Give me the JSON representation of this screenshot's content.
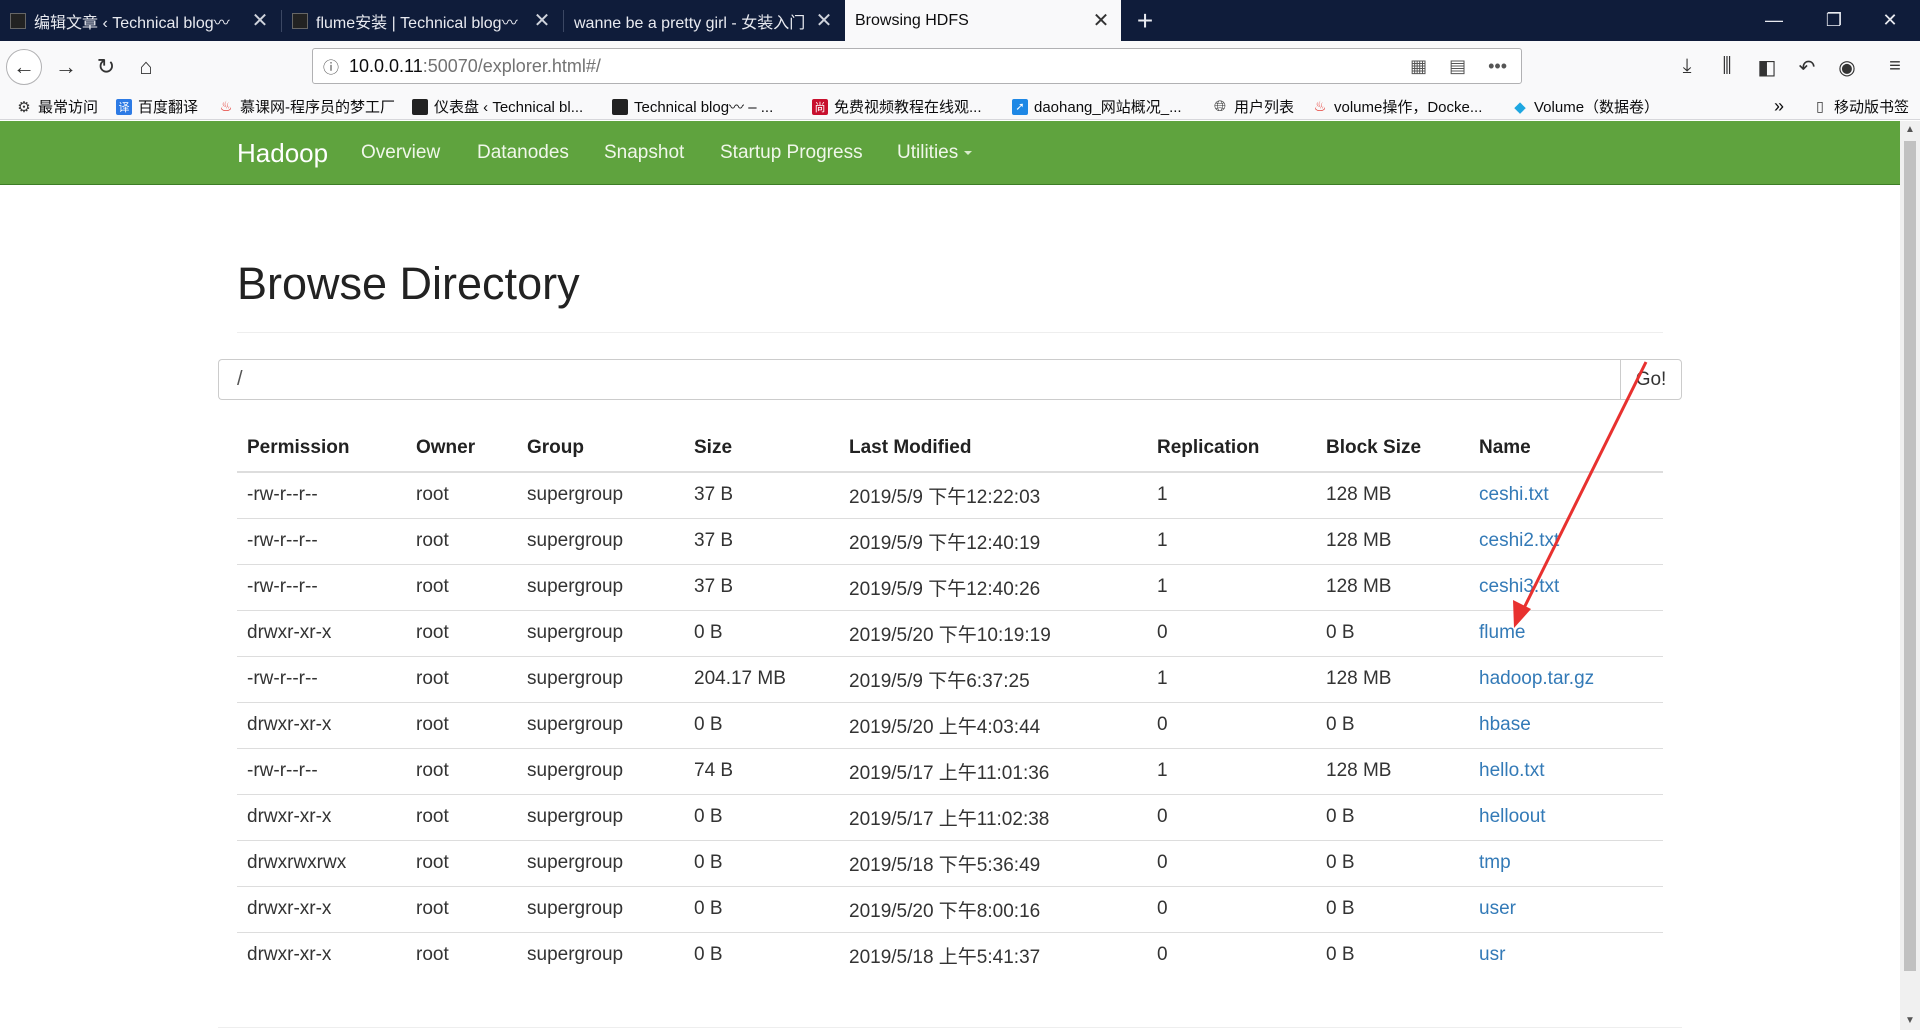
{
  "browser": {
    "tabs": [
      {
        "label": "编辑文章 ‹ Technical blog〰",
        "close": "✕"
      },
      {
        "label": "flume安装 | Technical blog〰",
        "close": "✕"
      },
      {
        "label": "wanne be a pretty girl - 女装入门",
        "close": "✕"
      },
      {
        "label": "Browsing HDFS",
        "close": "✕"
      }
    ],
    "new_tab": "+",
    "window_controls": {
      "minimize": "—",
      "restore": "❐",
      "close": "✕"
    },
    "url": {
      "host": "10.0.0.11",
      "path": ":50070/explorer.html#/"
    },
    "bookmarks": [
      {
        "label": "最常访问",
        "icon": "gear-icon"
      },
      {
        "label": "百度翻译",
        "icon": "translate-icon",
        "icon_text": "译",
        "color": "#2d7be5"
      },
      {
        "label": "慕课网-程序员的梦工厂",
        "icon": "flame-icon",
        "color": "#e2231a"
      },
      {
        "label": "仪表盘 ‹ Technical bl...",
        "icon": "site-icon"
      },
      {
        "label": "Technical blog〰 – ...",
        "icon": "site-icon"
      },
      {
        "label": "免费视频教程在线观...",
        "icon": "shang-icon",
        "icon_text": "尚",
        "color": "#c8102e"
      },
      {
        "label": "daohang_网站概况_...",
        "icon": "bolt-icon",
        "color": "#1e88e5"
      },
      {
        "label": "用户列表",
        "icon": "globe-icon"
      },
      {
        "label": "volume操作，Docke...",
        "icon": "flame-icon",
        "color": "#e2231a"
      },
      {
        "label": "Volume（数据卷）",
        "icon": "diamond-icon",
        "color": "#1ea7e1"
      }
    ],
    "bookmarks_overflow": "»",
    "mobile_bookmarks": "移动版书签"
  },
  "hadoop": {
    "brand": "Hadoop",
    "nav": [
      "Overview",
      "Datanodes",
      "Snapshot",
      "Startup Progress",
      "Utilities"
    ]
  },
  "page": {
    "title": "Browse Directory",
    "path_input": "/",
    "go_label": "Go!"
  },
  "table": {
    "headers": [
      "Permission",
      "Owner",
      "Group",
      "Size",
      "Last Modified",
      "Replication",
      "Block Size",
      "Name"
    ],
    "rows": [
      [
        "-rw-r--r--",
        "root",
        "supergroup",
        "37 B",
        "2019/5/9 下午12:22:03",
        "1",
        "128 MB",
        "ceshi.txt"
      ],
      [
        "-rw-r--r--",
        "root",
        "supergroup",
        "37 B",
        "2019/5/9 下午12:40:19",
        "1",
        "128 MB",
        "ceshi2.txt"
      ],
      [
        "-rw-r--r--",
        "root",
        "supergroup",
        "37 B",
        "2019/5/9 下午12:40:26",
        "1",
        "128 MB",
        "ceshi3.txt"
      ],
      [
        "drwxr-xr-x",
        "root",
        "supergroup",
        "0 B",
        "2019/5/20 下午10:19:19",
        "0",
        "0 B",
        "flume"
      ],
      [
        "-rw-r--r--",
        "root",
        "supergroup",
        "204.17 MB",
        "2019/5/9 下午6:37:25",
        "1",
        "128 MB",
        "hadoop.tar.gz"
      ],
      [
        "drwxr-xr-x",
        "root",
        "supergroup",
        "0 B",
        "2019/5/20 上午4:03:44",
        "0",
        "0 B",
        "hbase"
      ],
      [
        "-rw-r--r--",
        "root",
        "supergroup",
        "74 B",
        "2019/5/17 上午11:01:36",
        "1",
        "128 MB",
        "hello.txt"
      ],
      [
        "drwxr-xr-x",
        "root",
        "supergroup",
        "0 B",
        "2019/5/17 上午11:02:38",
        "0",
        "0 B",
        "helloout"
      ],
      [
        "drwxrwxrwx",
        "root",
        "supergroup",
        "0 B",
        "2019/5/18 下午5:36:49",
        "0",
        "0 B",
        "tmp"
      ],
      [
        "drwxr-xr-x",
        "root",
        "supergroup",
        "0 B",
        "2019/5/20 下午8:00:16",
        "0",
        "0 B",
        "user"
      ],
      [
        "drwxr-xr-x",
        "root",
        "supergroup",
        "0 B",
        "2019/5/18 上午5:41:37",
        "0",
        "0 B",
        "usr"
      ]
    ]
  },
  "colors": {
    "hadoop_green": "#5fa33e",
    "link_blue": "#337ab7",
    "tabbar": "#0f1c3a",
    "annotation_arrow": "#e8312f"
  }
}
